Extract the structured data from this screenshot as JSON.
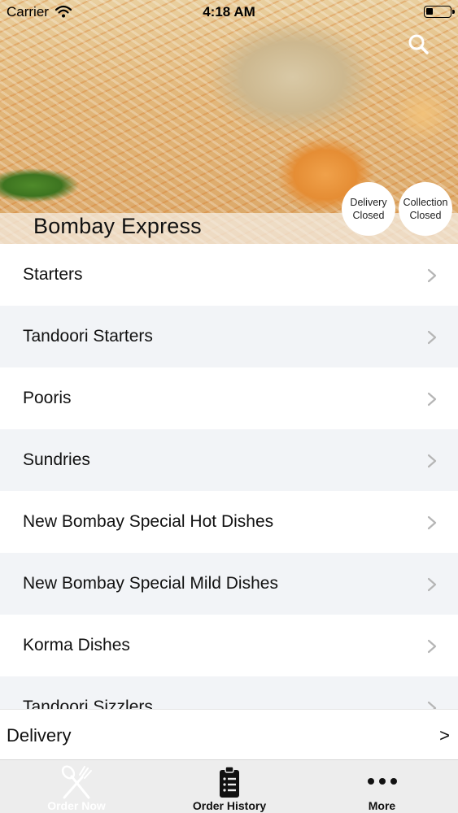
{
  "status_bar": {
    "carrier": "Carrier",
    "time": "4:18 AM",
    "battery_level": 0.3
  },
  "header": {
    "restaurant_name": "Bombay Express",
    "search_icon": "search-icon",
    "delivery_status": {
      "line1": "Delivery",
      "line2": "Closed"
    },
    "collection_status": {
      "line1": "Collection",
      "line2": "Closed"
    }
  },
  "menu": {
    "categories": [
      {
        "label": "Starters"
      },
      {
        "label": "Tandoori Starters"
      },
      {
        "label": "Pooris"
      },
      {
        "label": "Sundries"
      },
      {
        "label": "New Bombay Special Hot Dishes"
      },
      {
        "label": "New Bombay Special Mild Dishes"
      },
      {
        "label": "Korma Dishes"
      },
      {
        "label": "Tandoori Sizzlers"
      }
    ],
    "chevron_icon": "chevron-right-icon"
  },
  "delivery_bar": {
    "label": "Delivery",
    "arrow": ">"
  },
  "tab_bar": {
    "tabs": [
      {
        "label": "Order Now",
        "icon": "fork-spoon-icon"
      },
      {
        "label": "Order History",
        "icon": "clipboard-list-icon"
      },
      {
        "label": "More",
        "icon": "more-dots-icon"
      }
    ],
    "active_color": "#ffffff",
    "inactive_color": "#111111"
  }
}
